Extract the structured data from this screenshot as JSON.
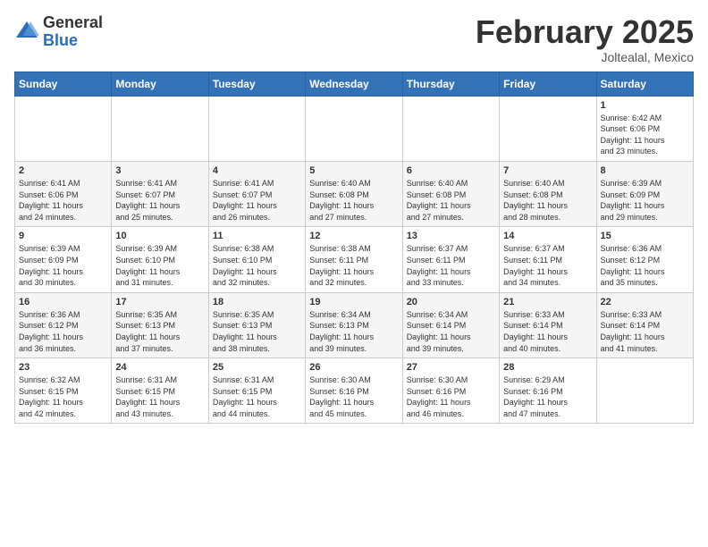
{
  "header": {
    "logo_general": "General",
    "logo_blue": "Blue",
    "title": "February 2025",
    "subtitle": "Joltealal, Mexico"
  },
  "weekdays": [
    "Sunday",
    "Monday",
    "Tuesday",
    "Wednesday",
    "Thursday",
    "Friday",
    "Saturday"
  ],
  "weeks": [
    [
      {
        "day": "",
        "info": ""
      },
      {
        "day": "",
        "info": ""
      },
      {
        "day": "",
        "info": ""
      },
      {
        "day": "",
        "info": ""
      },
      {
        "day": "",
        "info": ""
      },
      {
        "day": "",
        "info": ""
      },
      {
        "day": "1",
        "info": "Sunrise: 6:42 AM\nSunset: 6:06 PM\nDaylight: 11 hours\nand 23 minutes."
      }
    ],
    [
      {
        "day": "2",
        "info": "Sunrise: 6:41 AM\nSunset: 6:06 PM\nDaylight: 11 hours\nand 24 minutes."
      },
      {
        "day": "3",
        "info": "Sunrise: 6:41 AM\nSunset: 6:07 PM\nDaylight: 11 hours\nand 25 minutes."
      },
      {
        "day": "4",
        "info": "Sunrise: 6:41 AM\nSunset: 6:07 PM\nDaylight: 11 hours\nand 26 minutes."
      },
      {
        "day": "5",
        "info": "Sunrise: 6:40 AM\nSunset: 6:08 PM\nDaylight: 11 hours\nand 27 minutes."
      },
      {
        "day": "6",
        "info": "Sunrise: 6:40 AM\nSunset: 6:08 PM\nDaylight: 11 hours\nand 27 minutes."
      },
      {
        "day": "7",
        "info": "Sunrise: 6:40 AM\nSunset: 6:08 PM\nDaylight: 11 hours\nand 28 minutes."
      },
      {
        "day": "8",
        "info": "Sunrise: 6:39 AM\nSunset: 6:09 PM\nDaylight: 11 hours\nand 29 minutes."
      }
    ],
    [
      {
        "day": "9",
        "info": "Sunrise: 6:39 AM\nSunset: 6:09 PM\nDaylight: 11 hours\nand 30 minutes."
      },
      {
        "day": "10",
        "info": "Sunrise: 6:39 AM\nSunset: 6:10 PM\nDaylight: 11 hours\nand 31 minutes."
      },
      {
        "day": "11",
        "info": "Sunrise: 6:38 AM\nSunset: 6:10 PM\nDaylight: 11 hours\nand 32 minutes."
      },
      {
        "day": "12",
        "info": "Sunrise: 6:38 AM\nSunset: 6:11 PM\nDaylight: 11 hours\nand 32 minutes."
      },
      {
        "day": "13",
        "info": "Sunrise: 6:37 AM\nSunset: 6:11 PM\nDaylight: 11 hours\nand 33 minutes."
      },
      {
        "day": "14",
        "info": "Sunrise: 6:37 AM\nSunset: 6:11 PM\nDaylight: 11 hours\nand 34 minutes."
      },
      {
        "day": "15",
        "info": "Sunrise: 6:36 AM\nSunset: 6:12 PM\nDaylight: 11 hours\nand 35 minutes."
      }
    ],
    [
      {
        "day": "16",
        "info": "Sunrise: 6:36 AM\nSunset: 6:12 PM\nDaylight: 11 hours\nand 36 minutes."
      },
      {
        "day": "17",
        "info": "Sunrise: 6:35 AM\nSunset: 6:13 PM\nDaylight: 11 hours\nand 37 minutes."
      },
      {
        "day": "18",
        "info": "Sunrise: 6:35 AM\nSunset: 6:13 PM\nDaylight: 11 hours\nand 38 minutes."
      },
      {
        "day": "19",
        "info": "Sunrise: 6:34 AM\nSunset: 6:13 PM\nDaylight: 11 hours\nand 39 minutes."
      },
      {
        "day": "20",
        "info": "Sunrise: 6:34 AM\nSunset: 6:14 PM\nDaylight: 11 hours\nand 39 minutes."
      },
      {
        "day": "21",
        "info": "Sunrise: 6:33 AM\nSunset: 6:14 PM\nDaylight: 11 hours\nand 40 minutes."
      },
      {
        "day": "22",
        "info": "Sunrise: 6:33 AM\nSunset: 6:14 PM\nDaylight: 11 hours\nand 41 minutes."
      }
    ],
    [
      {
        "day": "23",
        "info": "Sunrise: 6:32 AM\nSunset: 6:15 PM\nDaylight: 11 hours\nand 42 minutes."
      },
      {
        "day": "24",
        "info": "Sunrise: 6:31 AM\nSunset: 6:15 PM\nDaylight: 11 hours\nand 43 minutes."
      },
      {
        "day": "25",
        "info": "Sunrise: 6:31 AM\nSunset: 6:15 PM\nDaylight: 11 hours\nand 44 minutes."
      },
      {
        "day": "26",
        "info": "Sunrise: 6:30 AM\nSunset: 6:16 PM\nDaylight: 11 hours\nand 45 minutes."
      },
      {
        "day": "27",
        "info": "Sunrise: 6:30 AM\nSunset: 6:16 PM\nDaylight: 11 hours\nand 46 minutes."
      },
      {
        "day": "28",
        "info": "Sunrise: 6:29 AM\nSunset: 6:16 PM\nDaylight: 11 hours\nand 47 minutes."
      },
      {
        "day": "",
        "info": ""
      }
    ]
  ]
}
